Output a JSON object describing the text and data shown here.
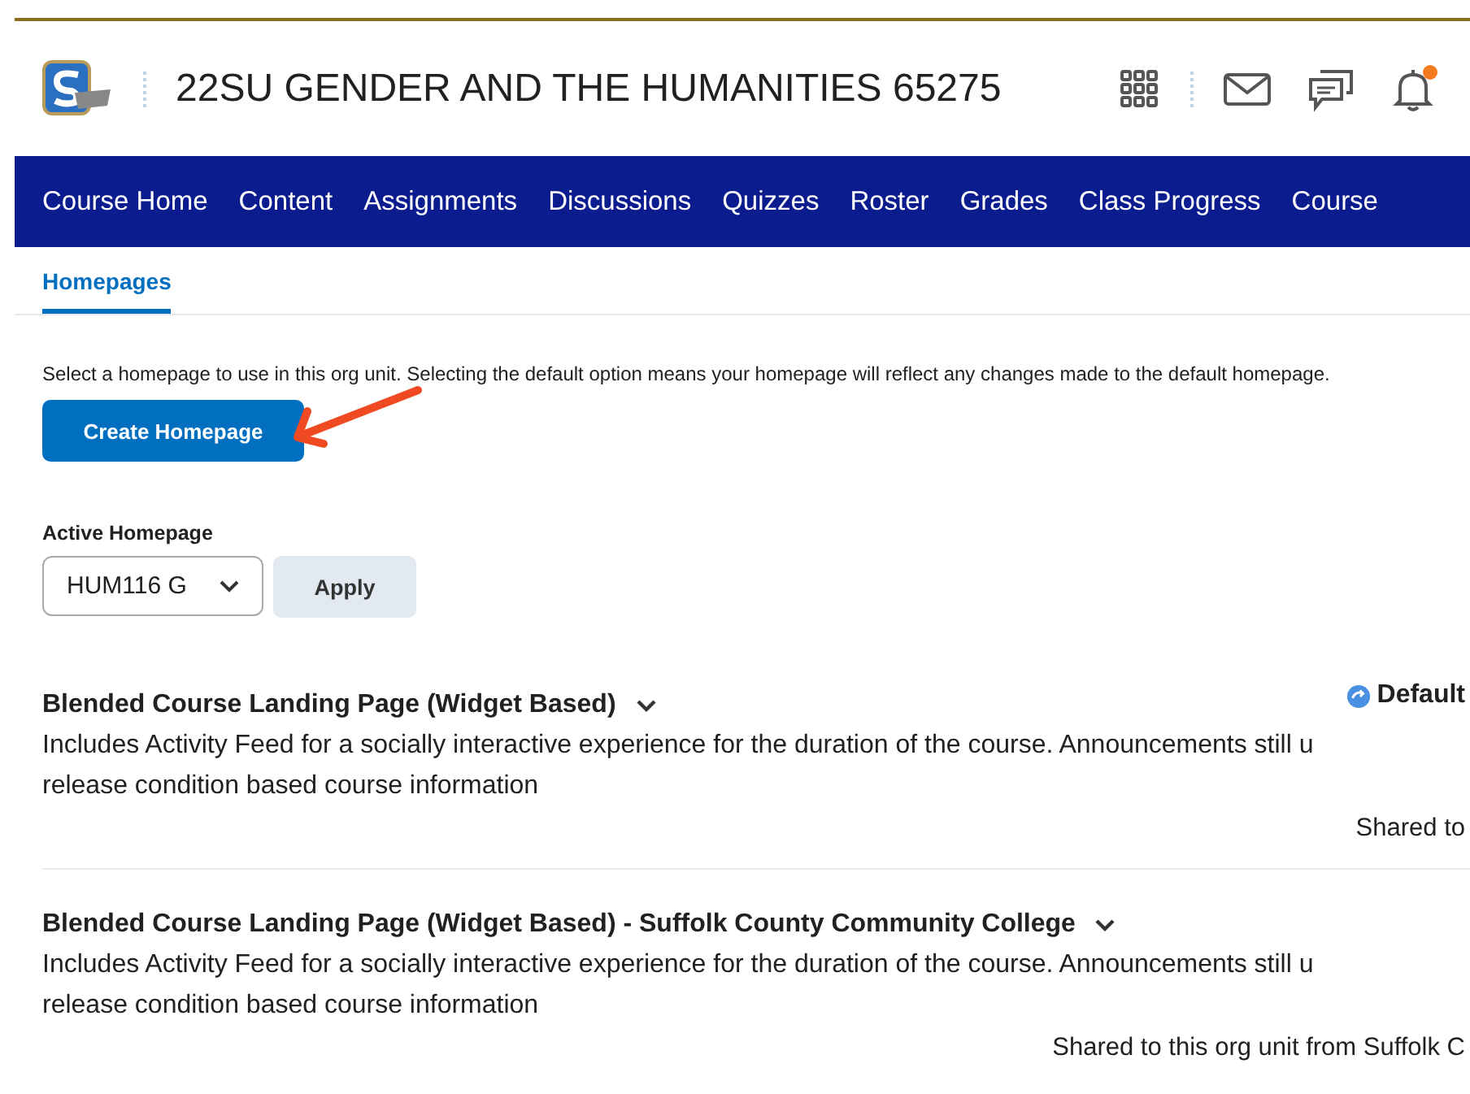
{
  "header": {
    "course_title": "22SU GENDER AND THE HUMANITIES 65275",
    "notification_dot": true
  },
  "nav": [
    "Course Home",
    "Content",
    "Assignments",
    "Discussions",
    "Quizzes",
    "Roster",
    "Grades",
    "Class Progress",
    "Course"
  ],
  "tabs": [
    {
      "label": "Homepages",
      "selected": true
    }
  ],
  "instruction": "Select a homepage to use in this org unit. Selecting the default option means your homepage will reflect any changes made to the default homepage.",
  "create_button": "Create Homepage",
  "active_homepage": {
    "label": "Active Homepage",
    "value": "HUM116 G",
    "apply": "Apply"
  },
  "homepages": [
    {
      "title": "Blended Course Landing Page (Widget Based)",
      "badge": "Default",
      "description_lines": [
        "Includes Activity Feed for a socially interactive experience for the duration of the course.  Announcements still u",
        "release condition based course information"
      ],
      "shared": "Shared to"
    },
    {
      "title": "Blended Course Landing Page (Widget Based) - Suffolk County Community College",
      "description_lines": [
        "Includes Activity Feed for a socially interactive experience for the duration of the course.  Announcements still u",
        "release condition based course information"
      ],
      "shared": "Shared to this org unit from Suffolk C"
    }
  ]
}
